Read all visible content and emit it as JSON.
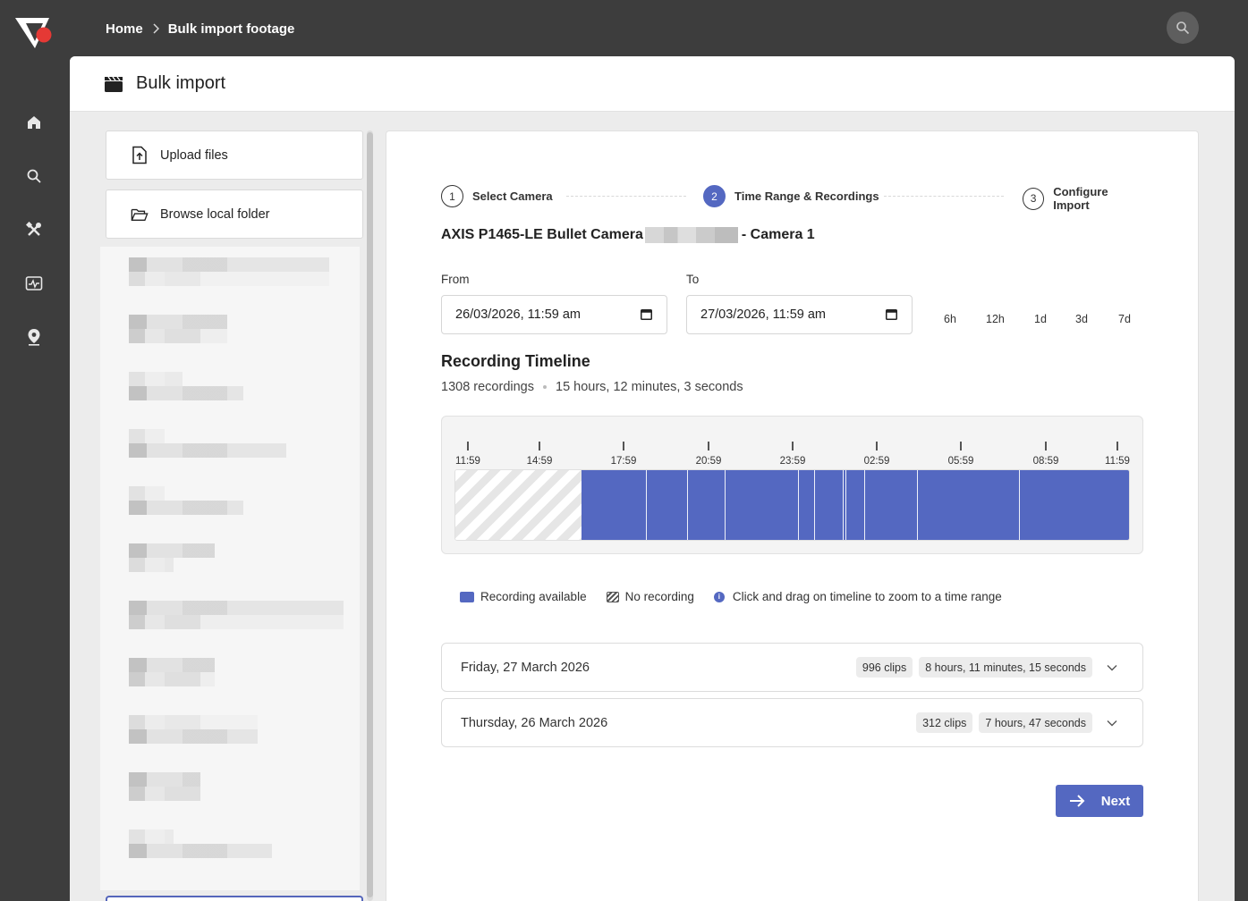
{
  "breadcrumb": {
    "home": "Home",
    "current": "Bulk import footage"
  },
  "rail": {
    "icons": [
      "home-icon",
      "search-icon",
      "tools-icon",
      "activity-icon",
      "location-icon"
    ]
  },
  "header": {
    "title": "Bulk import",
    "icon": "clapperboard-icon"
  },
  "sidebar": {
    "upload_files": "Upload files",
    "browse_folder": "Browse local folder"
  },
  "wizard": {
    "steps": [
      {
        "num": "1",
        "label": "Select Camera"
      },
      {
        "num": "2",
        "label": "Time Range & Recordings"
      },
      {
        "num": "3",
        "label": "Configure Import"
      }
    ],
    "active_step": 2
  },
  "camera": {
    "name_prefix": "AXIS P1465-LE Bullet Camera",
    "name_suffix": "- Camera 1"
  },
  "range": {
    "from_label": "From",
    "from_value": "26/03/2026, 11:59 am",
    "to_label": "To",
    "to_value": "27/03/2026, 11:59 am",
    "quick_options": [
      "6h",
      "12h",
      "1d",
      "3d",
      "7d"
    ]
  },
  "timeline": {
    "title": "Recording Timeline",
    "count": "1308 recordings",
    "duration": "15 hours, 12 minutes, 3 seconds",
    "tick_labels": [
      "11:59",
      "14:59",
      "17:59",
      "20:59",
      "23:59",
      "02:59",
      "05:59",
      "08:59",
      "11:59"
    ],
    "recording_start_fraction": 0.187,
    "segment_boundaries": [
      0.282,
      0.343,
      0.399,
      0.507,
      0.531,
      0.573,
      0.577,
      0.605,
      0.683,
      0.834
    ]
  },
  "legend": {
    "available": "Recording available",
    "none": "No recording",
    "hint": "Click and drag on timeline to zoom to a time range"
  },
  "days": [
    {
      "label": "Friday, 27 March 2026",
      "clips": "996 clips",
      "duration": "8 hours, 11 minutes, 15 seconds"
    },
    {
      "label": "Thursday, 26 March 2026",
      "clips": "312 clips",
      "duration": "7 hours, 47 seconds"
    }
  ],
  "next_label": "Next",
  "colors": {
    "accent": "#5468c1",
    "chrome": "#3d3d3d",
    "logo_red": "#e53935"
  }
}
